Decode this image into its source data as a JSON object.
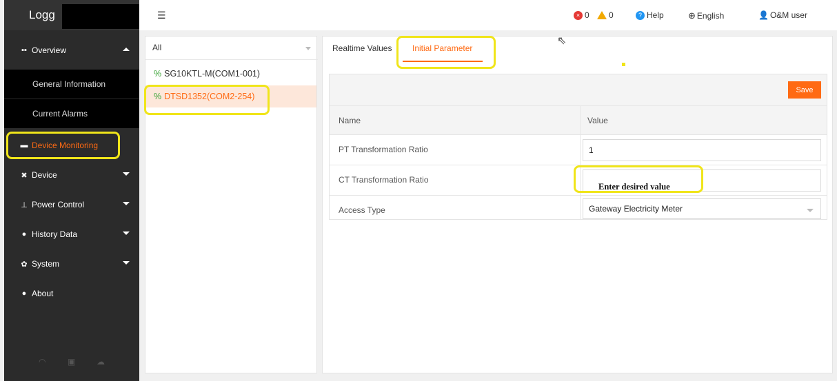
{
  "app": {
    "logo_text": "Logg"
  },
  "topbar": {
    "errors_count": "0",
    "warnings_count": "0",
    "help_label": "Help",
    "language_label": "English",
    "user_label": "O&M user"
  },
  "sidebar": {
    "overview_label": "Overview",
    "general_info_label": "General Information",
    "current_alarms_label": "Current Alarms",
    "device_monitoring_label": "Device Monitoring",
    "device_label": "Device",
    "power_control_label": "Power Control",
    "history_data_label": "History Data",
    "system_label": "System",
    "about_label": "About"
  },
  "device_list": {
    "filter_value": "All",
    "items": [
      {
        "label": "SG10KTL-M(COM1-001)"
      },
      {
        "label": "DTSD1352(COM2-254)"
      }
    ]
  },
  "main": {
    "tabs": [
      {
        "label": "Realtime Values"
      },
      {
        "label": "Initial Parameter"
      }
    ],
    "save_label": "Save",
    "table": {
      "header_name": "Name",
      "header_value": "Value",
      "rows": [
        {
          "name": "PT Transformation Ratio",
          "value": "1"
        },
        {
          "name": "CT Transformation Ratio",
          "value": "",
          "note": "Enter desired value"
        },
        {
          "name": "Access Type",
          "value": "Gateway Electricity Meter"
        }
      ]
    }
  },
  "colors": {
    "accent": "#ff6a13",
    "highlight": "#f0e51a",
    "sidebar_bg": "#2b2b2b"
  }
}
